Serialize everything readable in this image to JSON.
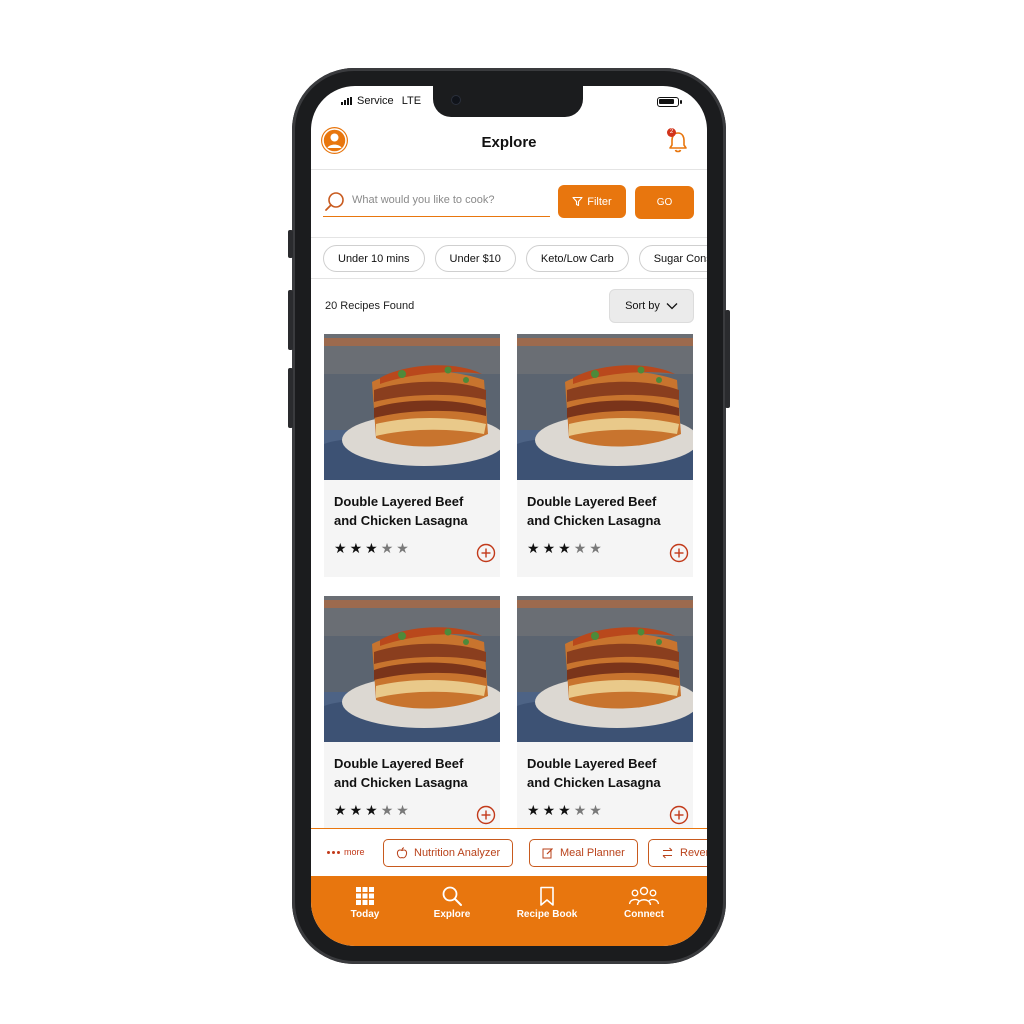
{
  "status_bar": {
    "carrier": "Service",
    "network": "LTE"
  },
  "header": {
    "title": "Explore",
    "notification_count": "2"
  },
  "search": {
    "placeholder": "What would you like to cook?",
    "filter_label": "Filter",
    "go_label": "GO"
  },
  "chips": [
    "Under 10 mins",
    "Under $10",
    "Keto/Low Carb",
    "Sugar Conscious"
  ],
  "results": {
    "count_text": "20 Recipes Found",
    "sort_label": "Sort by"
  },
  "recipes": [
    {
      "title_line1": "Double Layered Beef",
      "title_line2": "and Chicken Lasagna",
      "rating": 3,
      "max_rating": 5
    },
    {
      "title_line1": "Double Layered Beef",
      "title_line2": "and Chicken Lasagna",
      "rating": 3,
      "max_rating": 5
    },
    {
      "title_line1": "Double Layered Beef",
      "title_line2": "and Chicken Lasagna",
      "rating": 3,
      "max_rating": 5
    },
    {
      "title_line1": "Double Layered Beef",
      "title_line2": "and Chicken Lasagna",
      "rating": 3,
      "max_rating": 5
    }
  ],
  "quick_actions": {
    "more_label": "more",
    "items": [
      "Nutrition Analyzer",
      "Meal Planner",
      "Reverse Search"
    ]
  },
  "tabbar": {
    "items": [
      "Today",
      "Explore",
      "Recipe Book",
      "Connect"
    ]
  },
  "colors": {
    "accent": "#e8760e",
    "accent_dark": "#c23a1a",
    "card_bg": "#f5f5f5"
  }
}
